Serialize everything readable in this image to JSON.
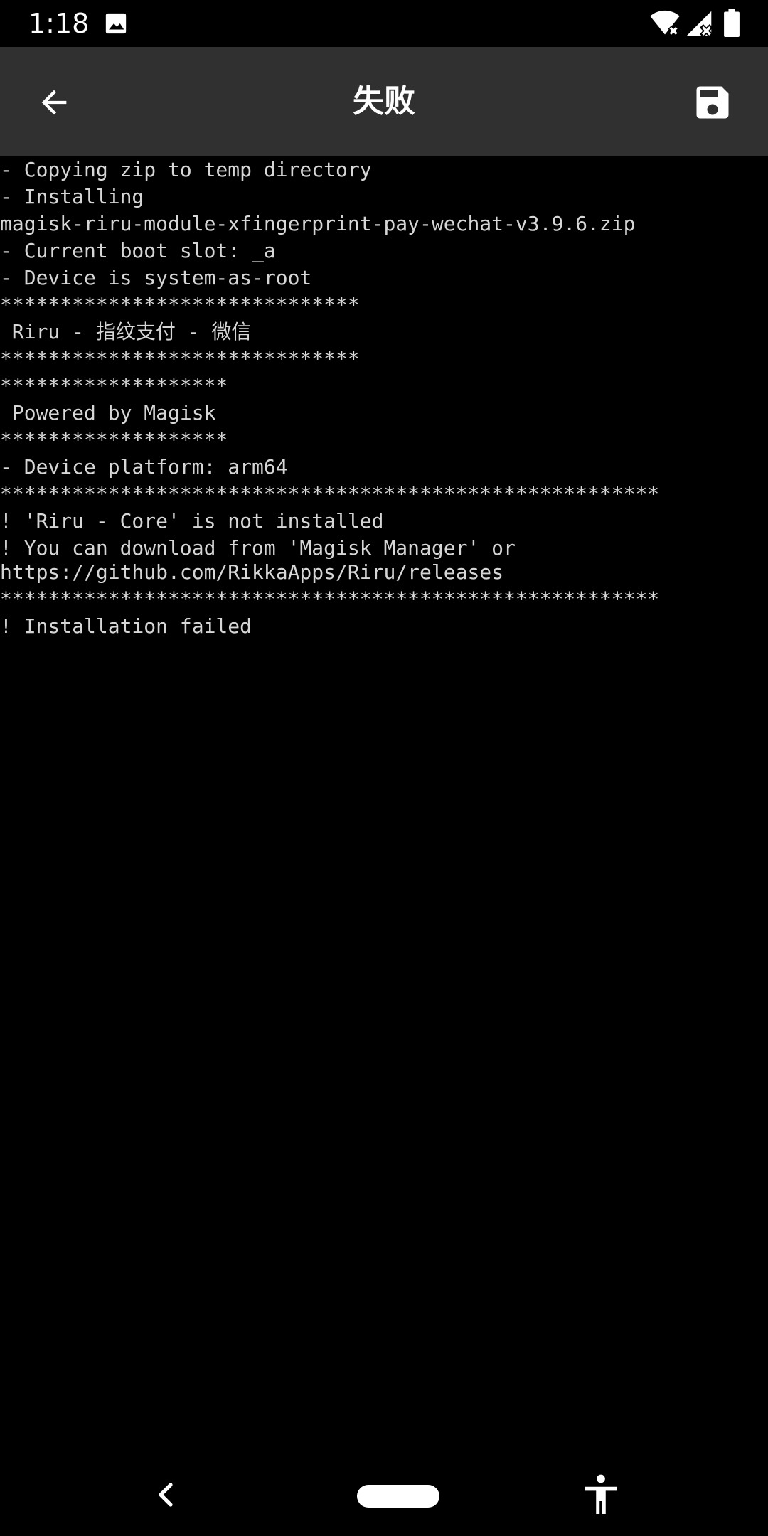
{
  "status_bar": {
    "time": "1:18",
    "icons": [
      "image-icon",
      "wifi-off-icon",
      "signal-off-icon",
      "battery-icon"
    ]
  },
  "app_bar": {
    "title": "失败",
    "back_icon": "arrow-back-icon",
    "save_icon": "save-icon"
  },
  "console": {
    "lines": [
      "- Copying zip to temp directory",
      "- Installing",
      "magisk-riru-module-xfingerprint-pay-wechat-v3.9.6.zip",
      "- Current boot slot: _a",
      "- Device is system-as-root",
      "******************************",
      " Riru - 指纹支付 - 微信",
      "******************************",
      "*******************",
      " Powered by Magisk",
      "*******************",
      "- Device platform: arm64",
      "*******************************************************",
      "! 'Riru - Core' is not installed",
      "! You can download from 'Magisk Manager' or https://github.com/RikkaApps/Riru/releases",
      "*******************************************************",
      "! Installation failed"
    ]
  },
  "nav_bar": {
    "icons": [
      "nav-back-icon",
      "nav-home-pill",
      "accessibility-icon"
    ]
  },
  "colors": {
    "app_bar_bg": "#303030",
    "console_bg": "#000000",
    "console_text": "#d6d6d6",
    "title_text": "#ffffff"
  }
}
